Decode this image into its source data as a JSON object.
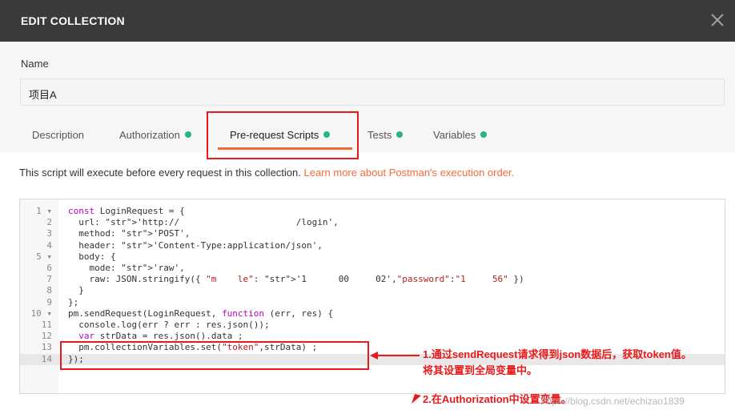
{
  "window": {
    "title": "EDIT COLLECTION"
  },
  "form": {
    "name_label": "Name",
    "name_value": "项目A"
  },
  "tabs": [
    {
      "label": "Description",
      "dot": false
    },
    {
      "label": "Authorization",
      "dot": true
    },
    {
      "label": "Pre-request Scripts",
      "dot": true,
      "active": true
    },
    {
      "label": "Tests",
      "dot": true
    },
    {
      "label": "Variables",
      "dot": true
    }
  ],
  "info": {
    "text": "This script will execute before every request in this collection.",
    "link": "Learn more about Postman's execution order."
  },
  "editor": {
    "lines": [
      {
        "n": "1 ▾",
        "code": "const LoginRequest = {"
      },
      {
        "n": "2",
        "code": "  url: 'http://                      /login',"
      },
      {
        "n": "3",
        "code": "  method: 'POST',"
      },
      {
        "n": "4",
        "code": "  header: 'Content-Type:application/json',"
      },
      {
        "n": "5 ▾",
        "code": "  body: {"
      },
      {
        "n": "6",
        "code": "    mode: 'raw',"
      },
      {
        "n": "7",
        "code": "    raw: JSON.stringify({ \"m    le\": '1      00     02',\"password\":\"1     56\" })"
      },
      {
        "n": "8",
        "code": "  }"
      },
      {
        "n": "9",
        "code": "};"
      },
      {
        "n": "10 ▾",
        "code": "pm.sendRequest(LoginRequest, function (err, res) {"
      },
      {
        "n": "11",
        "code": "  console.log(err ? err : res.json());"
      },
      {
        "n": "12",
        "code": "  var strData = res.json().data ;"
      },
      {
        "n": "13",
        "code": "  pm.collectionVariables.set(\"token\",strData) ;"
      },
      {
        "n": "14",
        "code": "});"
      }
    ]
  },
  "annotations": {
    "note1_line1": "1.通过sendRequest请求得到json数据后，获取token值。",
    "note1_line2": "将其设置到全局变量中。",
    "note2": "2.在Authorization中设置变量。",
    "watermark": "https://blog.csdn.net/echizao1839"
  },
  "colors": {
    "accent": "#f26b3a",
    "dot": "#26b47f",
    "highlight": "#e8191a",
    "titlebar": "#3a3a3a"
  }
}
